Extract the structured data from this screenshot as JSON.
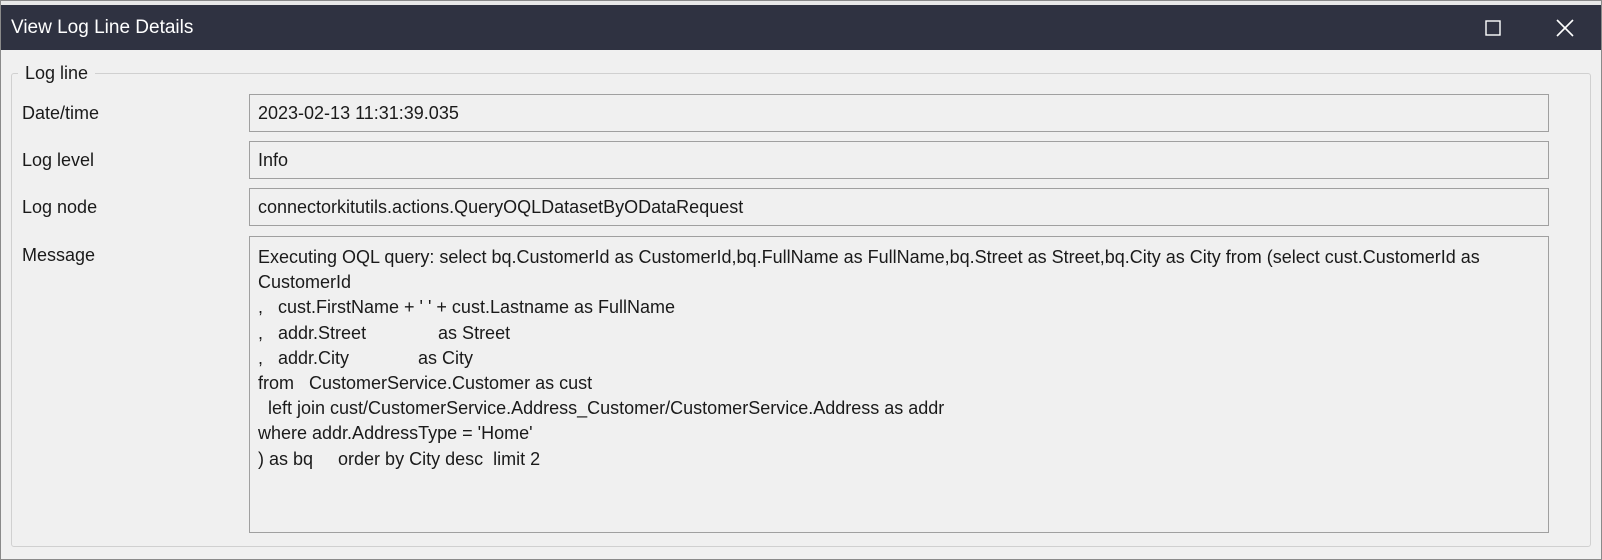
{
  "window": {
    "title": "View Log Line Details",
    "maximize_icon": "maximize-icon",
    "close_icon": "close-icon"
  },
  "group": {
    "legend": "Log line"
  },
  "fields": {
    "datetime": {
      "label": "Date/time",
      "value": "2023-02-13 11:31:39.035"
    },
    "level": {
      "label": "Log level",
      "value": "Info"
    },
    "node": {
      "label": "Log node",
      "value": "connectorkitutils.actions.QueryOQLDatasetByODataRequest"
    },
    "message": {
      "label": "Message",
      "value": "Executing OQL query: select bq.CustomerId as CustomerId,bq.FullName as FullName,bq.Street as Street,bq.City as City from (select cust.CustomerId as CustomerId\n,\tcust.FirstName + ' ' + cust.Lastname as FullName\n,\taddr.Street\t\t\t\tas Street\n,\taddr.City\t\t\t\tas City\nfrom   CustomerService.Customer as cust\n  left join cust/CustomerService.Address_Customer/CustomerService.Address as addr\nwhere addr.AddressType = 'Home'\n) as bq     order by City desc  limit 2"
    }
  }
}
